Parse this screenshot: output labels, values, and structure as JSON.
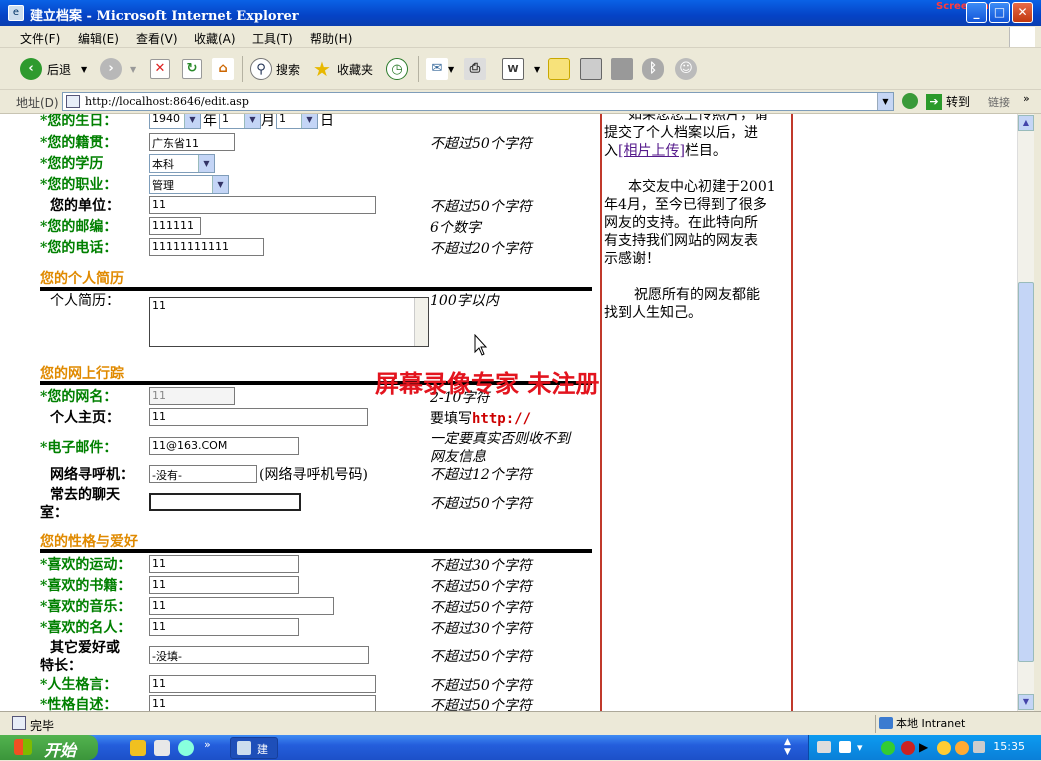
{
  "window": {
    "title": "建立档案 - Microsoft Internet Explorer",
    "watermark": "ScreenCap"
  },
  "menu": [
    "文件(F)",
    "编辑(E)",
    "查看(V)",
    "收藏(A)",
    "工具(T)",
    "帮助(H)"
  ],
  "toolbar": {
    "back": "后退",
    "search": "搜索",
    "favorites": "收藏夹"
  },
  "address": {
    "label": "地址(D)",
    "url": "http://localhost:8646/edit.asp",
    "go": "转到",
    "links": "链接"
  },
  "form": {
    "birthday": {
      "label": "*您的生日：",
      "year": "1940",
      "year_unit": "年",
      "month": "1",
      "month_unit": "月",
      "day": "1",
      "day_unit": "日"
    },
    "hometown": {
      "label": "*您的籍贯：",
      "value": "广东省11",
      "note": "不超过50个字符"
    },
    "education": {
      "label": "*您的学历",
      "value": "本科"
    },
    "job": {
      "label": "*您的职业：",
      "value": "管理"
    },
    "company": {
      "label": "您的单位：",
      "value": "11",
      "note": "不超过50个字符"
    },
    "zip": {
      "label": "*您的邮编：",
      "value": "111111",
      "note": "6个数字"
    },
    "phone": {
      "label": "*您的电话：",
      "value": "11111111111",
      "note": "不超过20个字符"
    },
    "section_resume": "您的个人简历",
    "resume": {
      "label": "个人简历：",
      "value": "11",
      "note": "100字以内"
    },
    "section_online": "您的网上行踪",
    "nickname": {
      "label": "*您的网名：",
      "value": "11",
      "note": "2-10字符"
    },
    "homepage": {
      "label": "个人主页：",
      "value": "11",
      "note_prefix": "要填写",
      "note_code": "http://"
    },
    "email": {
      "label": "*电子邮件：",
      "value": "11@163.COM",
      "note_line1": "一定要真实否则收不到",
      "note_line2": "网友信息"
    },
    "pager": {
      "label": "网络寻呼机：",
      "value": "-没有-",
      "hint": "(网络寻呼机号码)",
      "note": "不超过12个字符"
    },
    "chatroom": {
      "label_line1": "常去的聊天",
      "label_line2": "室：",
      "value": "",
      "note": "不超过50个字符"
    },
    "section_hobby": "您的性格与爱好",
    "sports": {
      "label": "*喜欢的运动：",
      "value": "11",
      "note": "不超过30个字符"
    },
    "books": {
      "label": "*喜欢的书籍：",
      "value": "11",
      "note": "不超过50个字符"
    },
    "music": {
      "label": "*喜欢的音乐：",
      "value": "11",
      "note": "不超过50个字符"
    },
    "celebrity": {
      "label": "*喜欢的名人：",
      "value": "11",
      "note": "不超过30个字符"
    },
    "other": {
      "label_line1": "其它爱好或",
      "label_line2": "特长：",
      "value": "-没填-",
      "note": "不超过50个字符"
    },
    "motto": {
      "label": "*人生格言：",
      "value": "11",
      "note": "不超过50个字符"
    },
    "self": {
      "label": "*性格自述：",
      "value": "11",
      "note": "不超过50个字符"
    }
  },
  "side": {
    "p1_cut": "如果您您上传照片，请",
    "p1_a": "提交了个人档案以后，进",
    "p1_b_prefix": "入",
    "p1_link": "[相片上传]",
    "p1_b_suffix": "栏目。",
    "p2_l1": "本交友中心初建于2001",
    "p2_l2": "年4月，至今已得到了很多",
    "p2_l3": "网友的支持。在此特向所",
    "p2_l4": "有支持我们网站的网友表",
    "p2_l5": "示感谢！",
    "p3_l1": "祝愿所有的网友都能",
    "p3_l2": "找到人生知己。"
  },
  "overlay_watermark": "屏幕录像专家  未注册",
  "status": {
    "text": "完毕",
    "zone": "本地 Intranet"
  },
  "taskbar": {
    "start": "开始",
    "item": "建",
    "clock": "15:35"
  }
}
